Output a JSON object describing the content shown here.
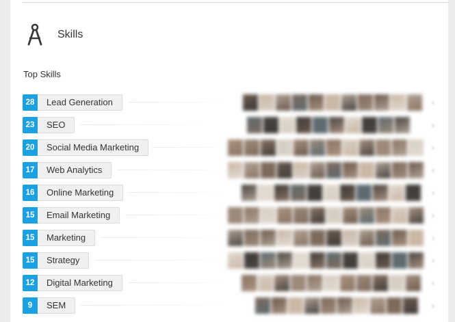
{
  "section": {
    "title": "Skills",
    "icon": "compass-icon"
  },
  "subsection": {
    "title": "Top Skills"
  },
  "skills": [
    {
      "count": "28",
      "name": "Lead Generation"
    },
    {
      "count": "23",
      "name": "SEO"
    },
    {
      "count": "20",
      "name": "Social Media Marketing"
    },
    {
      "count": "17",
      "name": "Web Analytics"
    },
    {
      "count": "16",
      "name": "Online Marketing"
    },
    {
      "count": "15",
      "name": "Email Marketing"
    },
    {
      "count": "15",
      "name": "Marketing"
    },
    {
      "count": "15",
      "name": "Strategy"
    },
    {
      "count": "12",
      "name": "Digital Marketing"
    },
    {
      "count": "9",
      "name": "SEM"
    }
  ],
  "colors": {
    "count_badge": "#1ba1e2",
    "pill_bg": "#f0f0f0",
    "text": "#333333"
  }
}
